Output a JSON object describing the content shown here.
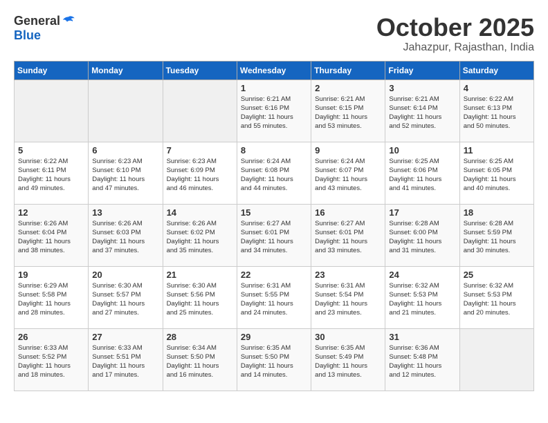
{
  "logo": {
    "general": "General",
    "blue": "Blue"
  },
  "title": "October 2025",
  "subtitle": "Jahazpur, Rajasthan, India",
  "days_of_week": [
    "Sunday",
    "Monday",
    "Tuesday",
    "Wednesday",
    "Thursday",
    "Friday",
    "Saturday"
  ],
  "weeks": [
    [
      {
        "day": "",
        "info": ""
      },
      {
        "day": "",
        "info": ""
      },
      {
        "day": "",
        "info": ""
      },
      {
        "day": "1",
        "info": "Sunrise: 6:21 AM\nSunset: 6:16 PM\nDaylight: 11 hours\nand 55 minutes."
      },
      {
        "day": "2",
        "info": "Sunrise: 6:21 AM\nSunset: 6:15 PM\nDaylight: 11 hours\nand 53 minutes."
      },
      {
        "day": "3",
        "info": "Sunrise: 6:21 AM\nSunset: 6:14 PM\nDaylight: 11 hours\nand 52 minutes."
      },
      {
        "day": "4",
        "info": "Sunrise: 6:22 AM\nSunset: 6:13 PM\nDaylight: 11 hours\nand 50 minutes."
      }
    ],
    [
      {
        "day": "5",
        "info": "Sunrise: 6:22 AM\nSunset: 6:11 PM\nDaylight: 11 hours\nand 49 minutes."
      },
      {
        "day": "6",
        "info": "Sunrise: 6:23 AM\nSunset: 6:10 PM\nDaylight: 11 hours\nand 47 minutes."
      },
      {
        "day": "7",
        "info": "Sunrise: 6:23 AM\nSunset: 6:09 PM\nDaylight: 11 hours\nand 46 minutes."
      },
      {
        "day": "8",
        "info": "Sunrise: 6:24 AM\nSunset: 6:08 PM\nDaylight: 11 hours\nand 44 minutes."
      },
      {
        "day": "9",
        "info": "Sunrise: 6:24 AM\nSunset: 6:07 PM\nDaylight: 11 hours\nand 43 minutes."
      },
      {
        "day": "10",
        "info": "Sunrise: 6:25 AM\nSunset: 6:06 PM\nDaylight: 11 hours\nand 41 minutes."
      },
      {
        "day": "11",
        "info": "Sunrise: 6:25 AM\nSunset: 6:05 PM\nDaylight: 11 hours\nand 40 minutes."
      }
    ],
    [
      {
        "day": "12",
        "info": "Sunrise: 6:26 AM\nSunset: 6:04 PM\nDaylight: 11 hours\nand 38 minutes."
      },
      {
        "day": "13",
        "info": "Sunrise: 6:26 AM\nSunset: 6:03 PM\nDaylight: 11 hours\nand 37 minutes."
      },
      {
        "day": "14",
        "info": "Sunrise: 6:26 AM\nSunset: 6:02 PM\nDaylight: 11 hours\nand 35 minutes."
      },
      {
        "day": "15",
        "info": "Sunrise: 6:27 AM\nSunset: 6:01 PM\nDaylight: 11 hours\nand 34 minutes."
      },
      {
        "day": "16",
        "info": "Sunrise: 6:27 AM\nSunset: 6:01 PM\nDaylight: 11 hours\nand 33 minutes."
      },
      {
        "day": "17",
        "info": "Sunrise: 6:28 AM\nSunset: 6:00 PM\nDaylight: 11 hours\nand 31 minutes."
      },
      {
        "day": "18",
        "info": "Sunrise: 6:28 AM\nSunset: 5:59 PM\nDaylight: 11 hours\nand 30 minutes."
      }
    ],
    [
      {
        "day": "19",
        "info": "Sunrise: 6:29 AM\nSunset: 5:58 PM\nDaylight: 11 hours\nand 28 minutes."
      },
      {
        "day": "20",
        "info": "Sunrise: 6:30 AM\nSunset: 5:57 PM\nDaylight: 11 hours\nand 27 minutes."
      },
      {
        "day": "21",
        "info": "Sunrise: 6:30 AM\nSunset: 5:56 PM\nDaylight: 11 hours\nand 25 minutes."
      },
      {
        "day": "22",
        "info": "Sunrise: 6:31 AM\nSunset: 5:55 PM\nDaylight: 11 hours\nand 24 minutes."
      },
      {
        "day": "23",
        "info": "Sunrise: 6:31 AM\nSunset: 5:54 PM\nDaylight: 11 hours\nand 23 minutes."
      },
      {
        "day": "24",
        "info": "Sunrise: 6:32 AM\nSunset: 5:53 PM\nDaylight: 11 hours\nand 21 minutes."
      },
      {
        "day": "25",
        "info": "Sunrise: 6:32 AM\nSunset: 5:53 PM\nDaylight: 11 hours\nand 20 minutes."
      }
    ],
    [
      {
        "day": "26",
        "info": "Sunrise: 6:33 AM\nSunset: 5:52 PM\nDaylight: 11 hours\nand 18 minutes."
      },
      {
        "day": "27",
        "info": "Sunrise: 6:33 AM\nSunset: 5:51 PM\nDaylight: 11 hours\nand 17 minutes."
      },
      {
        "day": "28",
        "info": "Sunrise: 6:34 AM\nSunset: 5:50 PM\nDaylight: 11 hours\nand 16 minutes."
      },
      {
        "day": "29",
        "info": "Sunrise: 6:35 AM\nSunset: 5:50 PM\nDaylight: 11 hours\nand 14 minutes."
      },
      {
        "day": "30",
        "info": "Sunrise: 6:35 AM\nSunset: 5:49 PM\nDaylight: 11 hours\nand 13 minutes."
      },
      {
        "day": "31",
        "info": "Sunrise: 6:36 AM\nSunset: 5:48 PM\nDaylight: 11 hours\nand 12 minutes."
      },
      {
        "day": "",
        "info": ""
      }
    ]
  ]
}
